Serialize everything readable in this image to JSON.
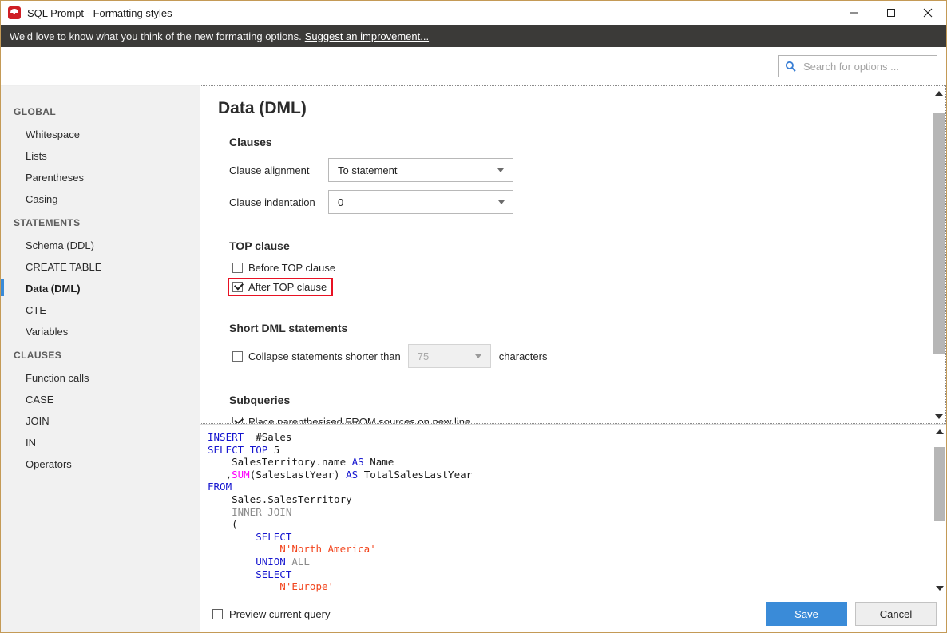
{
  "window": {
    "title": "SQL Prompt - Formatting styles",
    "icon": "redgate-logo-icon",
    "minimize_label": "minimize-icon",
    "maximize_label": "maximize-icon",
    "close_label": "close-icon",
    "border_color": "#c49a56"
  },
  "notice": {
    "text": "We'd love to know what you think of the new formatting options.",
    "link_text": "Suggest an improvement...",
    "background": "#3b3a38"
  },
  "search": {
    "placeholder": "Search for options ...",
    "value": "",
    "icon": "search-icon",
    "icon_color": "#3a7fd5"
  },
  "sidebar": {
    "groups": [
      {
        "label": "GLOBAL",
        "items": [
          {
            "label": "Whitespace",
            "selected": false
          },
          {
            "label": "Lists",
            "selected": false
          },
          {
            "label": "Parentheses",
            "selected": false
          },
          {
            "label": "Casing",
            "selected": false
          }
        ]
      },
      {
        "label": "STATEMENTS",
        "items": [
          {
            "label": "Schema (DDL)",
            "selected": false
          },
          {
            "label": "CREATE TABLE",
            "selected": false
          },
          {
            "label": "Data (DML)",
            "selected": true
          },
          {
            "label": "CTE",
            "selected": false
          },
          {
            "label": "Variables",
            "selected": false
          }
        ]
      },
      {
        "label": "CLAUSES",
        "items": [
          {
            "label": "Function calls",
            "selected": false
          },
          {
            "label": "CASE",
            "selected": false
          },
          {
            "label": "JOIN",
            "selected": false
          },
          {
            "label": "IN",
            "selected": false
          },
          {
            "label": "Operators",
            "selected": false
          }
        ]
      }
    ],
    "selection_accent": "#3a8bd8"
  },
  "options": {
    "page_title": "Data (DML)",
    "clauses": {
      "heading": "Clauses",
      "alignment_label": "Clause alignment",
      "alignment_value": "To statement",
      "indentation_label": "Clause indentation",
      "indentation_value": "0"
    },
    "top_clause": {
      "heading": "TOP clause",
      "before_label": "Before TOP clause",
      "before_checked": false,
      "after_label": "After TOP clause",
      "after_checked": true,
      "highlight_color": "#e81123"
    },
    "short_dml": {
      "heading": "Short DML statements",
      "collapse_label": "Collapse statements shorter than",
      "collapse_checked": false,
      "collapse_value": "75",
      "collapse_suffix": "characters",
      "collapse_enabled": false
    },
    "subqueries": {
      "heading": "Subqueries",
      "from_sources_label": "Place parenthesised FROM sources on new line",
      "from_sources_checked": true
    }
  },
  "preview": {
    "lines": [
      [
        {
          "t": "INSERT",
          "c": "kw"
        },
        {
          "t": "  ",
          "c": "plain"
        },
        {
          "t": "#Sales",
          "c": "plain"
        }
      ],
      [
        {
          "t": "SELECT",
          "c": "kw"
        },
        {
          "t": " ",
          "c": "plain"
        },
        {
          "t": "TOP",
          "c": "kw"
        },
        {
          "t": " 5",
          "c": "plain"
        }
      ],
      [
        {
          "t": "    SalesTerritory.name ",
          "c": "plain"
        },
        {
          "t": "AS",
          "c": "kw"
        },
        {
          "t": " Name",
          "c": "plain"
        }
      ],
      [
        {
          "t": "   ,",
          "c": "plain"
        },
        {
          "t": "SUM",
          "c": "fn"
        },
        {
          "t": "(SalesLastYear) ",
          "c": "plain"
        },
        {
          "t": "AS",
          "c": "kw"
        },
        {
          "t": " TotalSalesLastYear",
          "c": "plain"
        }
      ],
      [
        {
          "t": "FROM",
          "c": "kw"
        }
      ],
      [
        {
          "t": "    Sales.SalesTerritory",
          "c": "plain"
        }
      ],
      [
        {
          "t": "    INNER JOIN",
          "c": "gray"
        }
      ],
      [
        {
          "t": "    (",
          "c": "plain"
        }
      ],
      [
        {
          "t": "        SELECT",
          "c": "kw"
        }
      ],
      [
        {
          "t": "            N'North America'",
          "c": "str"
        }
      ],
      [
        {
          "t": "        UNION",
          "c": "kw"
        },
        {
          "t": " ALL",
          "c": "gray"
        }
      ],
      [
        {
          "t": "        SELECT",
          "c": "kw"
        }
      ],
      [
        {
          "t": "            N'Europe'",
          "c": "str"
        }
      ]
    ]
  },
  "footer": {
    "preview_label": "Preview current query",
    "preview_checked": false,
    "save_label": "Save",
    "cancel_label": "Cancel",
    "save_color": "#3a8bd8"
  },
  "scrollbars": {
    "options": {
      "thumb_top_pct": 4,
      "thumb_height_pct": 78
    },
    "code": {
      "thumb_top_pct": 6,
      "thumb_height_pct": 52
    }
  }
}
